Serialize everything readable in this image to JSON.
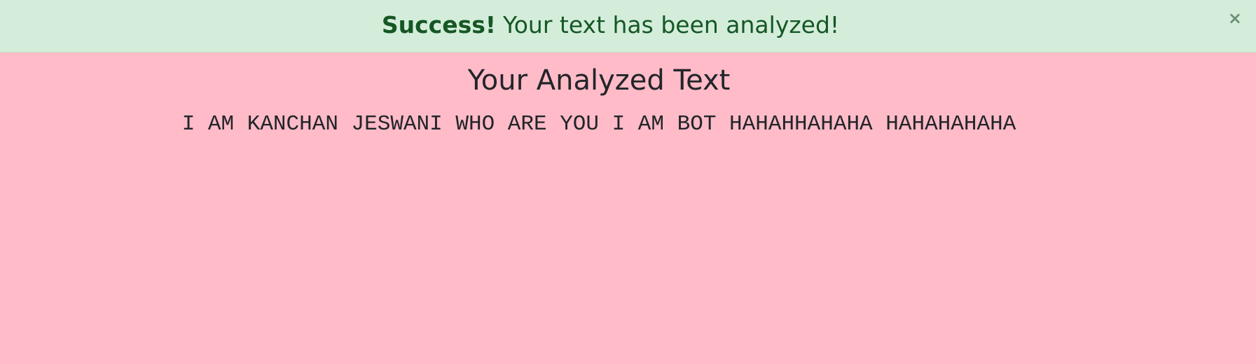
{
  "alert": {
    "strong": "Success!",
    "message": "Your text has been analyzed!",
    "close_label": "×"
  },
  "main": {
    "title": "Your Analyzed Text",
    "analyzed_text": "I AM KANCHAN JESWANI WHO ARE YOU I AM BOT HAHAHHAHAHA HAHAHAHAHA"
  },
  "colors": {
    "page_background": "#ffbbc8",
    "alert_background": "#d4eddb",
    "alert_text": "#155724"
  }
}
